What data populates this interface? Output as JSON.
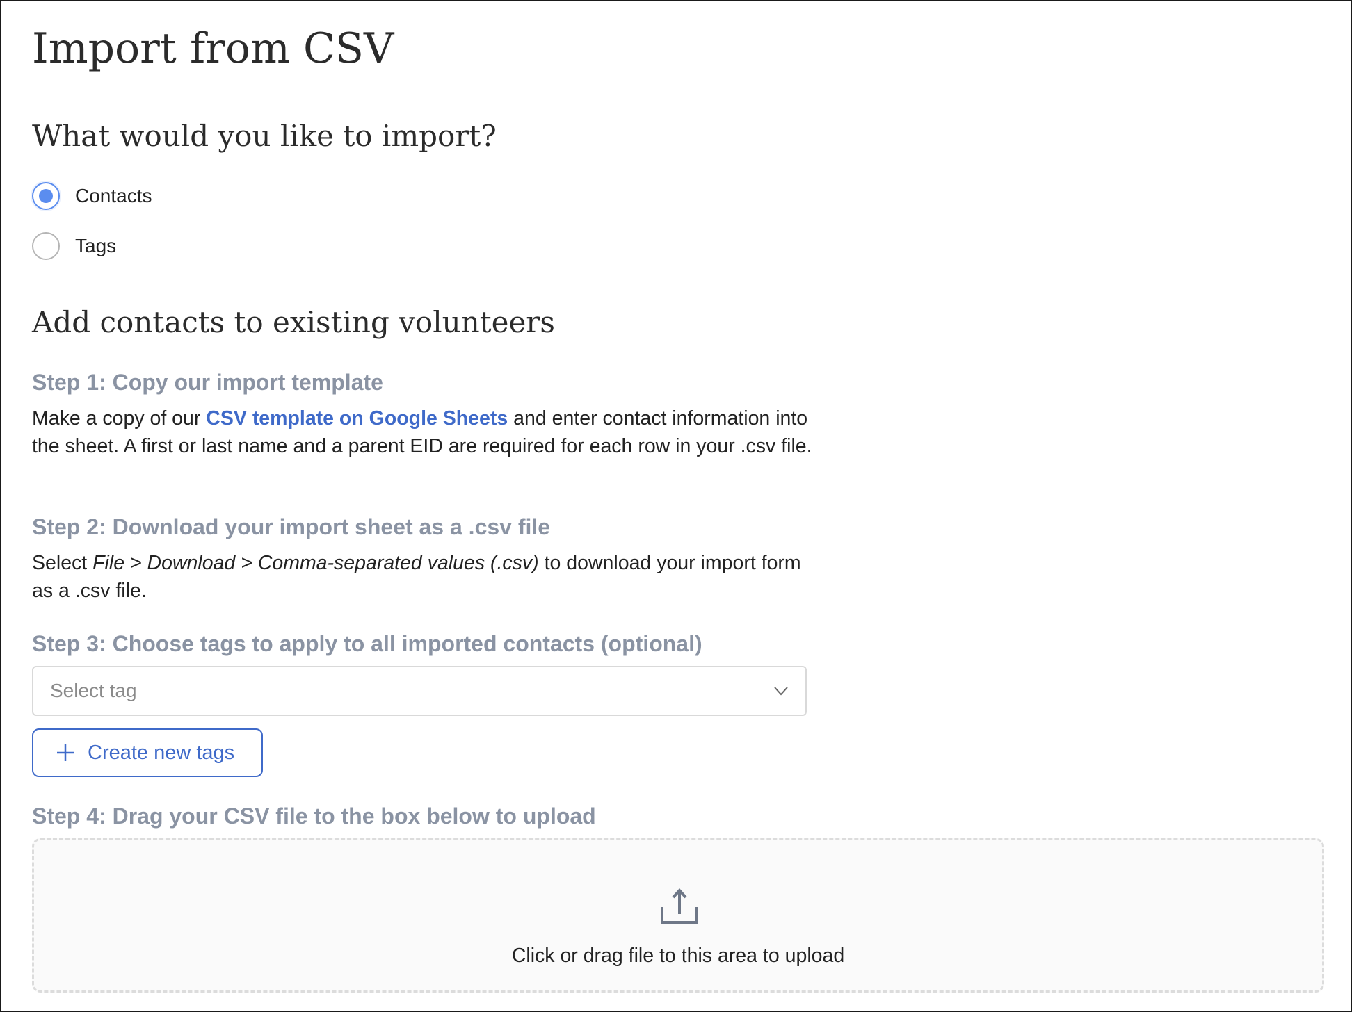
{
  "page": {
    "title": "Import from CSV"
  },
  "import_type": {
    "question": "What would you like to import?",
    "options": [
      {
        "label": "Contacts",
        "selected": true
      },
      {
        "label": "Tags",
        "selected": false
      }
    ]
  },
  "section": {
    "title": "Add contacts to existing volunteers"
  },
  "steps": {
    "step1": {
      "title": "Step 1: Copy our import template",
      "text_before": "Make a copy of our ",
      "link_text": "CSV template on Google Sheets",
      "text_after": " and enter contact information into the sheet. A first or last name and a parent EID are required for each row in your .csv file."
    },
    "step2": {
      "title": "Step 2: Download your import sheet as a .csv file",
      "text_before": "Select ",
      "menu_path": "File > Download > Comma-separated values (.csv)",
      "text_after": " to download your import form as a .csv file."
    },
    "step3": {
      "title": "Step 3: Choose tags to apply to all imported contacts (optional)",
      "select_placeholder": "Select tag",
      "create_button_label": "Create new tags"
    },
    "step4": {
      "title": "Step 4: Drag your CSV file to the box below to upload",
      "dropzone_text": "Click or drag file to this area to upload"
    }
  },
  "icons": {
    "select_arrow": "chevron-down-icon",
    "create_button": "plus-icon",
    "dropzone": "upload-icon"
  },
  "colors": {
    "accent": "#5b8def",
    "link": "#3f6ac9",
    "step_title": "#8a93a3"
  }
}
